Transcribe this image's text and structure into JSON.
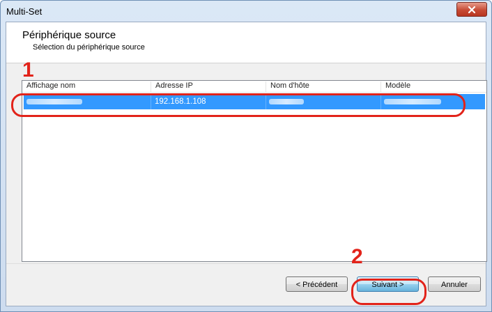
{
  "window": {
    "title": "Multi-Set",
    "close_icon": "close-icon"
  },
  "header": {
    "title": "Périphérique source",
    "subtitle": "Sélection du périphérique source"
  },
  "callouts": {
    "step1": "1",
    "step2": "2",
    "color": "#e2231a"
  },
  "table": {
    "columns": [
      "Affichage nom",
      "Adresse IP",
      "Nom d'hôte",
      "Modèle"
    ],
    "rows": [
      {
        "display_name": "",
        "ip_address": "192.168.1.108",
        "host_name": "",
        "model": "",
        "selected": true
      }
    ],
    "selection_color": "#3399ff"
  },
  "buttons": {
    "previous": "< Précédent",
    "next": "Suivant >",
    "cancel": "Annuler"
  }
}
